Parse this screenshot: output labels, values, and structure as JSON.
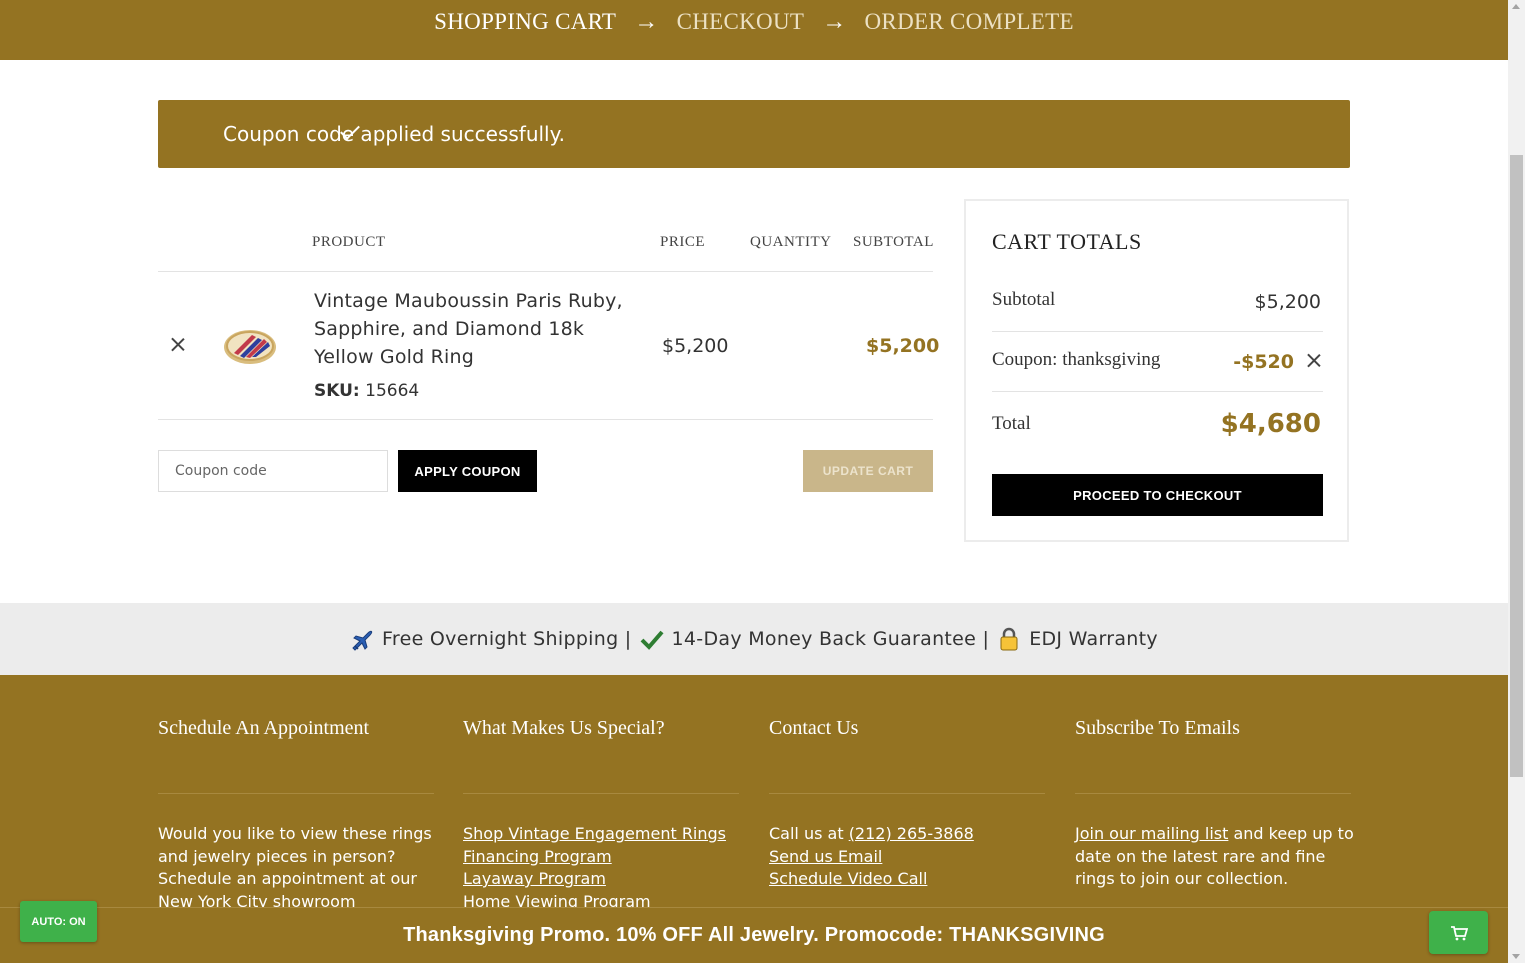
{
  "steps": {
    "step1": "SHOPPING CART",
    "step2": "CHECKOUT",
    "step3": "ORDER COMPLETE",
    "arrow": "→"
  },
  "notice": {
    "message": "Coupon code applied successfully."
  },
  "cart_table": {
    "headers": {
      "product": "PRODUCT",
      "price": "PRICE",
      "quantity": "QUANTITY",
      "subtotal": "SUBTOTAL"
    },
    "items": [
      {
        "name": "Vintage Mauboussin Paris Ruby, Sapphire, and Diamond 18k Yellow Gold Ring",
        "sku_label": "SKU:",
        "sku": "15664",
        "price": "$5,200",
        "subtotal": "$5,200"
      }
    ]
  },
  "coupon": {
    "placeholder": "Coupon code",
    "value": "",
    "apply_label": "APPLY COUPON",
    "update_label": "UPDATE CART"
  },
  "totals": {
    "title": "CART TOTALS",
    "subtotal_label": "Subtotal",
    "subtotal_value": "$5,200",
    "coupon_label": "Coupon: thanksgiving",
    "coupon_value": "-$520",
    "total_label": "Total",
    "total_value": "$4,680",
    "checkout_label": "PROCEED TO CHECKOUT"
  },
  "perks": {
    "shipping": "Free Overnight Shipping |",
    "guarantee": "14-Day Money Back Guarantee |",
    "warranty": "EDJ Warranty"
  },
  "footer": {
    "appointment": {
      "title": "Schedule An Appointment",
      "text": "Would you like to view these rings and jewelry pieces in person? Schedule an appointment at our New York City showroom"
    },
    "special": {
      "title": "What Makes Us Special?",
      "links": [
        "Shop Vintage Engagement Rings",
        "Financing Program",
        "Layaway Program",
        "Home Viewing Program"
      ]
    },
    "contact": {
      "title": "Contact Us",
      "call_prefix": "Call us at",
      "phone": "(212) 265-3868",
      "email_link": "Send us Email",
      "video_link": "Schedule Video Call"
    },
    "subscribe": {
      "title": "Subscribe To Emails",
      "link": "Join our mailing list",
      "text": " and keep up to date on the latest rare and fine rings to join our collection."
    }
  },
  "promo": {
    "text": "Thanksgiving Promo. 10% OFF All Jewelry. Promocode: THANKSGIVING"
  },
  "widgets": {
    "auto_label": "AUTO: ON"
  },
  "colors": {
    "gold": "#947322",
    "green": "#3fb14a",
    "black": "#000000"
  }
}
